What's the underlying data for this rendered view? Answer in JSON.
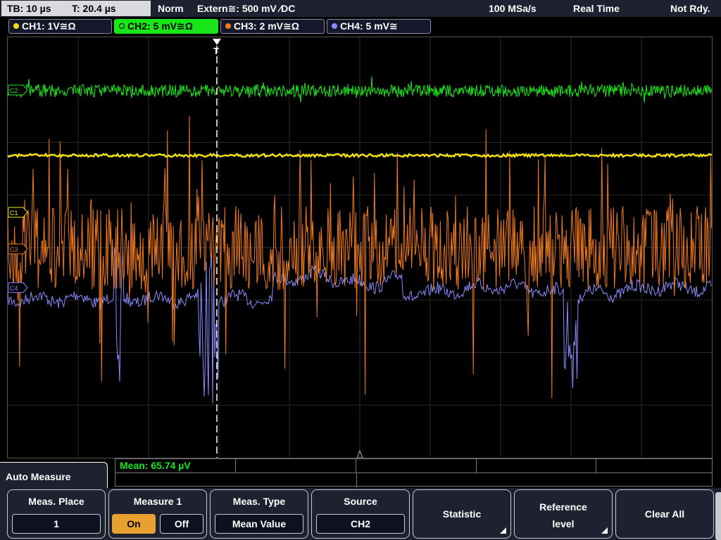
{
  "status": {
    "timebase": "TB: 10 µs",
    "trigger_time": "T: 20.4 µs",
    "mode": "Norm",
    "trigger_source": "Extern≅: 500 mV ⁄DC",
    "sample_rate": "100 MSa/s",
    "acq_mode": "Real Time",
    "state": "Not Rdy."
  },
  "channels": [
    {
      "label": "CH1: 1V≅Ω",
      "color": "#f0e010",
      "active": false
    },
    {
      "label": "CH2: 5 mV≅Ω",
      "color": "#19e619",
      "active": true
    },
    {
      "label": "CH3: 2 mV≅Ω",
      "color": "#f07a1c",
      "active": false
    },
    {
      "label": "CH4: 5 mV≅",
      "color": "#8a8aff",
      "active": false
    }
  ],
  "markers": {
    "ch2": "C2",
    "ch1": "C1",
    "ch3": "C3",
    "ch4": "C4",
    "trigger": "T"
  },
  "measurement": {
    "result": "Mean: 65.74 µV"
  },
  "menu": {
    "title": "Auto Measure",
    "meas_place": {
      "label": "Meas. Place",
      "value": "1"
    },
    "measure1": {
      "label": "Measure 1",
      "on": "On",
      "off": "Off",
      "state": "On"
    },
    "meas_type": {
      "label": "Meas. Type",
      "value": "Mean Value"
    },
    "source": {
      "label": "Source",
      "value": "CH2"
    },
    "statistic": {
      "label": "Statistic"
    },
    "reference_level": {
      "line1": "Reference",
      "line2": "level"
    },
    "clear_all": {
      "label": "Clear All"
    }
  }
}
